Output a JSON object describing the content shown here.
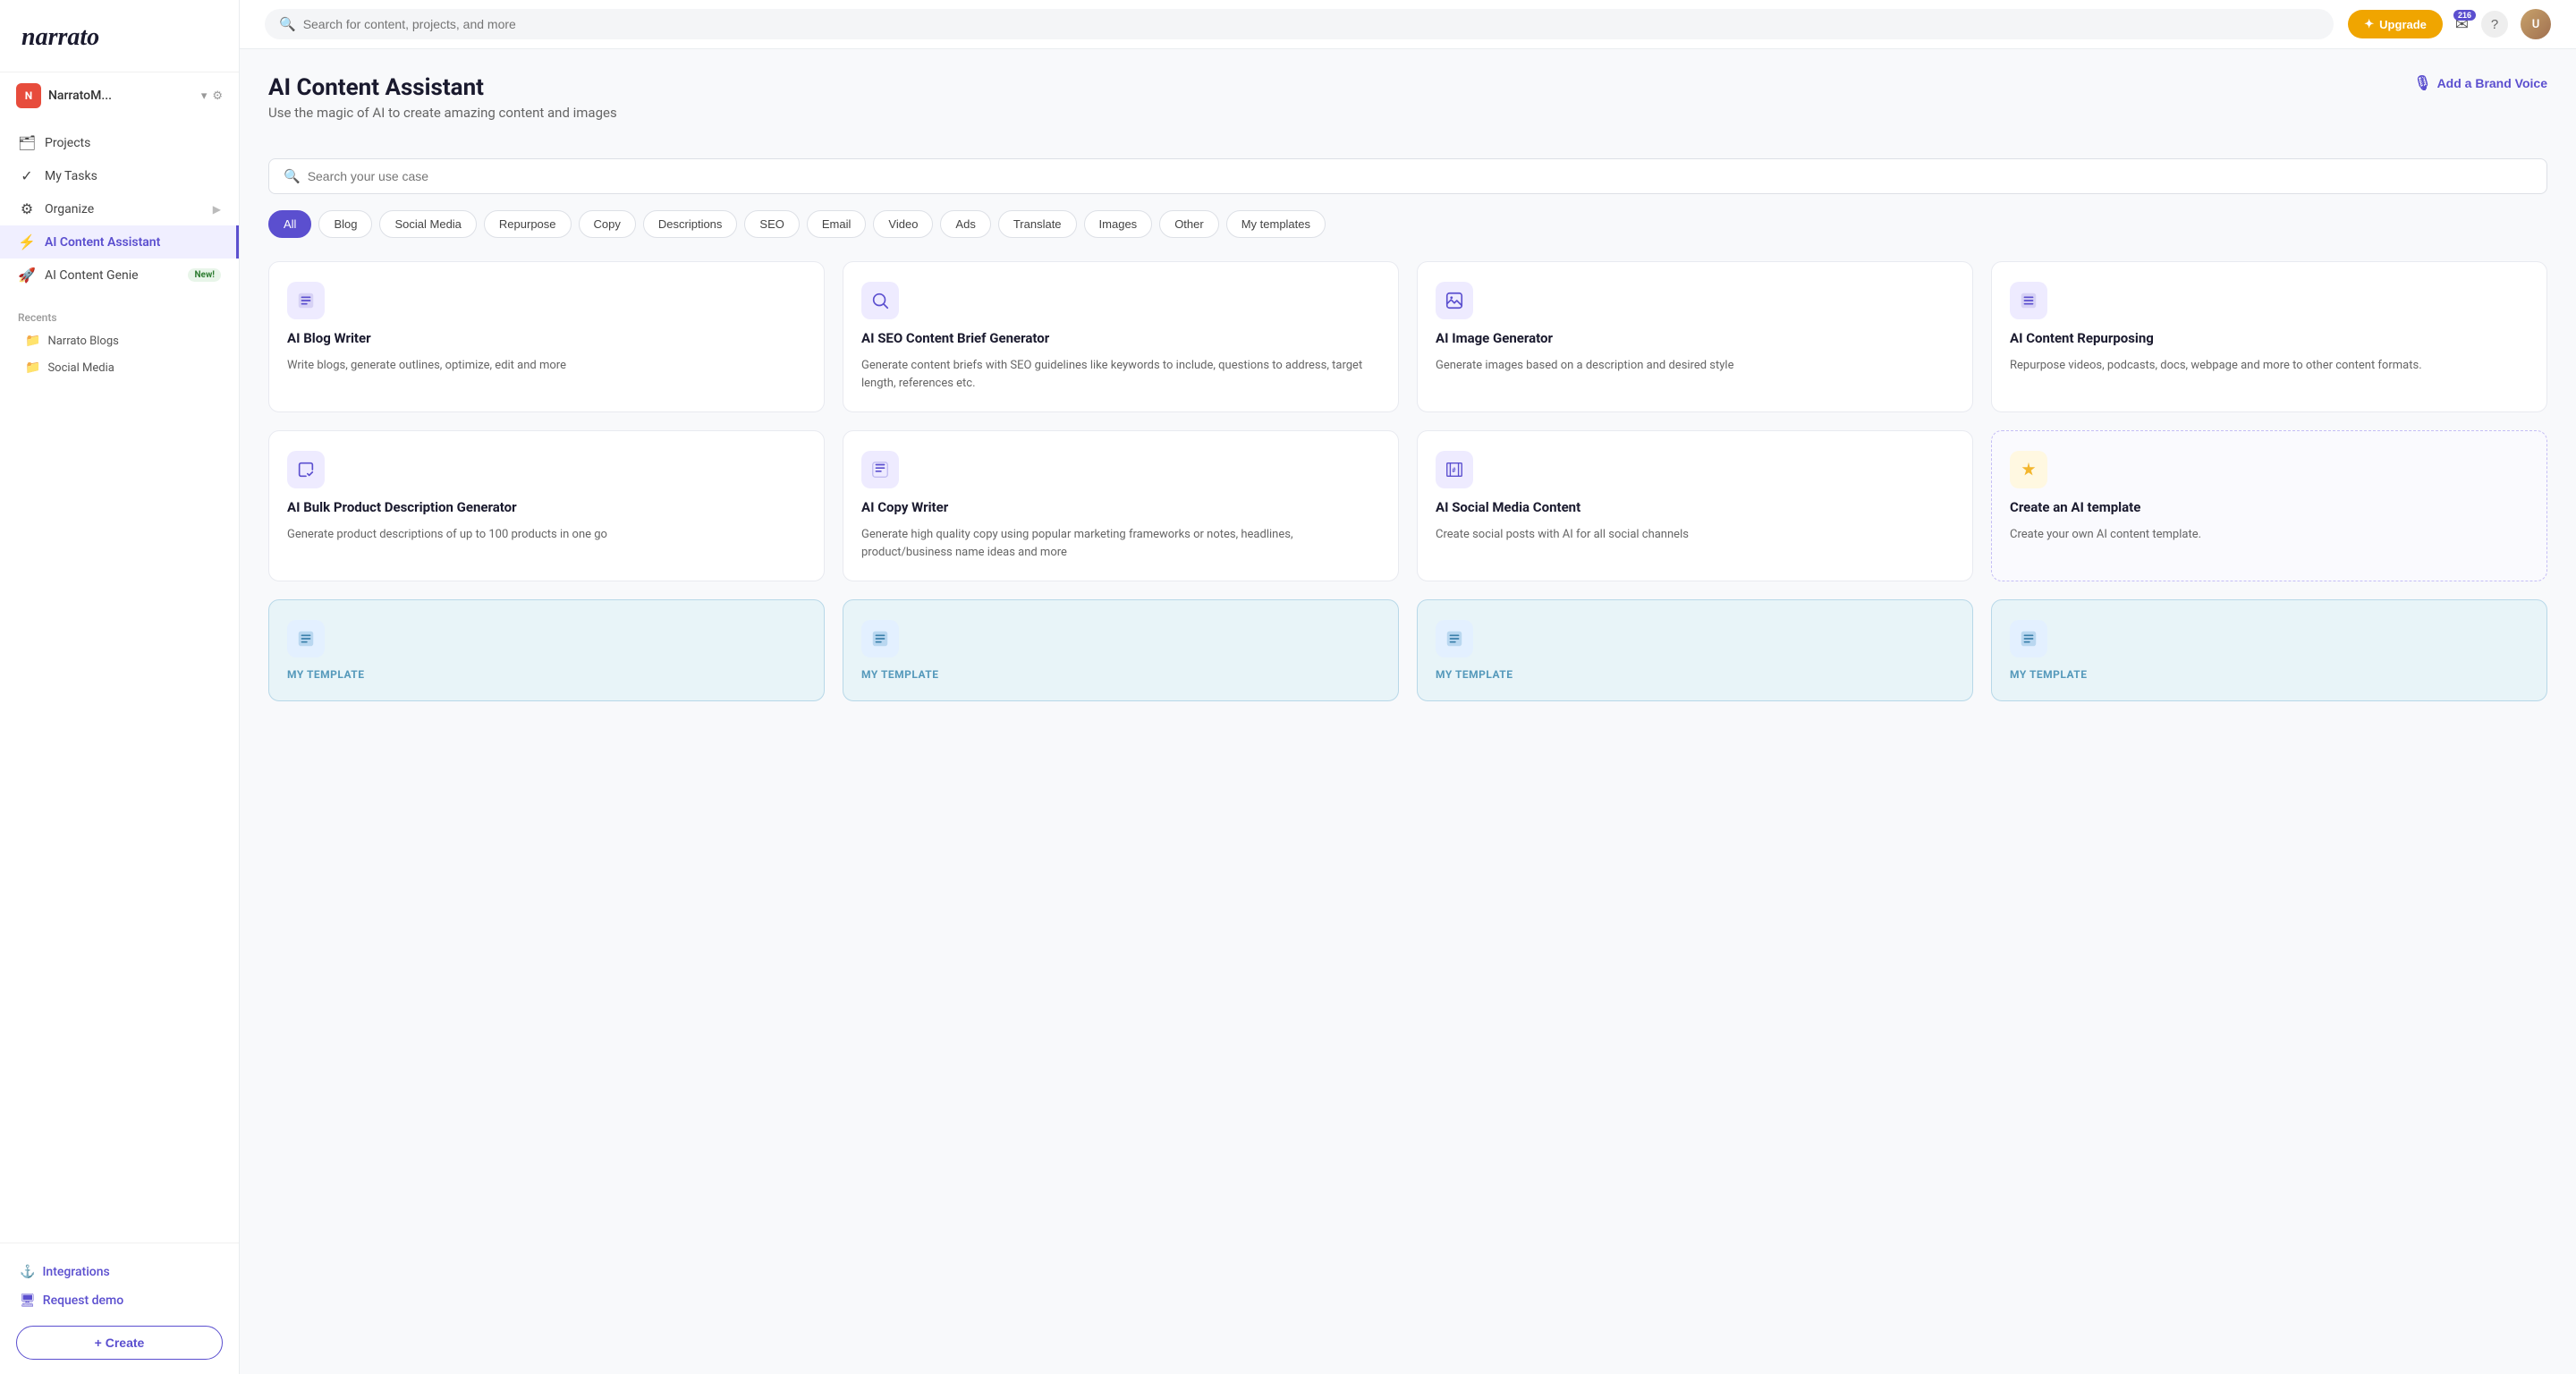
{
  "sidebar": {
    "logo_text": "narrato",
    "account": {
      "initial": "N",
      "name": "NarratoM..."
    },
    "nav_items": [
      {
        "id": "projects",
        "icon": "🗂",
        "label": "Projects"
      },
      {
        "id": "my-tasks",
        "icon": "✓",
        "label": "My Tasks"
      },
      {
        "id": "organize",
        "icon": "⚙",
        "label": "Organize",
        "has_arrow": true
      },
      {
        "id": "ai-content-assistant",
        "icon": "⚡",
        "label": "AI Content Assistant",
        "active": true
      },
      {
        "id": "ai-content-genie",
        "icon": "🚀",
        "label": "AI Content Genie",
        "badge": "New!"
      }
    ],
    "recents_label": "Recents",
    "recent_items": [
      {
        "icon": "📁",
        "label": "Narrato Blogs"
      },
      {
        "icon": "📁",
        "label": "Social Media"
      }
    ],
    "bottom_links": [
      {
        "id": "integrations",
        "icon": "⚓",
        "label": "Integrations"
      },
      {
        "id": "request-demo",
        "icon": "🖥",
        "label": "Request demo"
      }
    ],
    "create_label": "+ Create"
  },
  "topbar": {
    "search_placeholder": "Search for content, projects, and more",
    "upgrade_label": "Upgrade",
    "notif_count": "216",
    "help_label": "?"
  },
  "page": {
    "title": "AI Content Assistant",
    "subtitle": "Use the magic of AI to create amazing content and images",
    "add_brand_voice": "Add a Brand Voice",
    "use_case_search_placeholder": "Search your use case"
  },
  "filter_tabs": [
    {
      "id": "all",
      "label": "All",
      "active": true
    },
    {
      "id": "blog",
      "label": "Blog"
    },
    {
      "id": "social-media",
      "label": "Social Media"
    },
    {
      "id": "repurpose",
      "label": "Repurpose"
    },
    {
      "id": "copy",
      "label": "Copy"
    },
    {
      "id": "descriptions",
      "label": "Descriptions"
    },
    {
      "id": "seo",
      "label": "SEO"
    },
    {
      "id": "email",
      "label": "Email"
    },
    {
      "id": "video",
      "label": "Video"
    },
    {
      "id": "ads",
      "label": "Ads"
    },
    {
      "id": "translate",
      "label": "Translate"
    },
    {
      "id": "images",
      "label": "Images"
    },
    {
      "id": "other",
      "label": "Other"
    },
    {
      "id": "my-templates",
      "label": "My templates"
    }
  ],
  "cards": [
    {
      "id": "ai-blog-writer",
      "icon": "📄",
      "icon_type": "purple",
      "title": "AI Blog Writer",
      "desc": "Write blogs, generate outlines, optimize, edit and more",
      "type": "normal"
    },
    {
      "id": "ai-seo-brief",
      "icon": "🔍",
      "icon_type": "purple",
      "title": "AI SEO Content Brief Generator",
      "desc": "Generate content briefs with SEO guidelines like keywords to include, questions to address, target length, references etc.",
      "type": "normal"
    },
    {
      "id": "ai-image-generator",
      "icon": "🖼",
      "icon_type": "purple",
      "title": "AI Image Generator",
      "desc": "Generate images based on a description and desired style",
      "type": "normal"
    },
    {
      "id": "ai-content-repurposing",
      "icon": "📋",
      "icon_type": "purple",
      "title": "AI Content Repurposing",
      "desc": "Repurpose videos, podcasts, docs, webpage and more to other content formats.",
      "type": "normal"
    },
    {
      "id": "ai-bulk-product",
      "icon": "✏",
      "icon_type": "purple",
      "title": "AI Bulk Product Description Generator",
      "desc": "Generate product descriptions of up to 100 products in one go",
      "type": "normal"
    },
    {
      "id": "ai-copy-writer",
      "icon": "≡",
      "icon_type": "purple",
      "title": "AI Copy Writer",
      "desc": "Generate high quality copy using popular marketing frameworks or notes, headlines, product/business name ideas and more",
      "type": "normal"
    },
    {
      "id": "ai-social-media",
      "icon": "#",
      "icon_type": "purple",
      "title": "AI Social Media Content",
      "desc": "Create social posts with AI for all social channels",
      "type": "normal"
    },
    {
      "id": "create-ai-template",
      "icon": "⚡",
      "icon_type": "yellow",
      "title": "Create an AI template",
      "desc": "Create your own AI content template.",
      "type": "dashed"
    },
    {
      "id": "template-card-1",
      "icon": "≡",
      "icon_type": "blue",
      "title": "",
      "desc": "",
      "type": "template",
      "template_label": "MY TEMPLATE"
    },
    {
      "id": "template-card-2",
      "icon": "📄",
      "icon_type": "blue",
      "title": "",
      "desc": "",
      "type": "template",
      "template_label": "MY TEMPLATE"
    },
    {
      "id": "template-card-3",
      "icon": "📄",
      "icon_type": "blue",
      "title": "",
      "desc": "",
      "type": "template",
      "template_label": "MY TEMPLATE"
    },
    {
      "id": "template-card-4",
      "icon": "📄",
      "icon_type": "blue",
      "title": "",
      "desc": "",
      "type": "template",
      "template_label": "MY TEMPLATE"
    }
  ],
  "colors": {
    "accent": "#5b4fcf",
    "upgrade_bg": "#f0a500",
    "new_badge_bg": "#e8f5e9",
    "new_badge_text": "#2e7d32"
  }
}
